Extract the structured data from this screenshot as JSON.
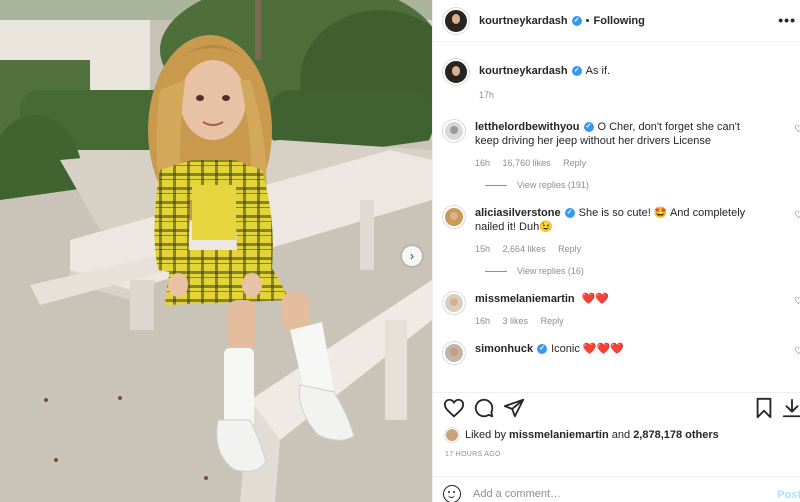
{
  "post": {
    "author": "kourtneykardash",
    "follow_state": "Following",
    "more_icon": "more-options-icon",
    "dot": "•",
    "verified_glyph": "✓"
  },
  "caption": {
    "username": "kourtneykardash",
    "text": "As if.",
    "time": "17h"
  },
  "comments": [
    {
      "username": "letthelordbewithyou",
      "verified": true,
      "text": "O Cher, don't forget she can't keep driving her jeep without her drivers License",
      "time": "16h",
      "likes": "16,760 likes",
      "reply_label": "Reply",
      "view_replies": "View replies (191)"
    },
    {
      "username": "aliciasilverstone",
      "verified": true,
      "text": "She is so cute! 🤩 And completely nailed it! Duh😉",
      "time": "15h",
      "likes": "2,664 likes",
      "reply_label": "Reply",
      "view_replies": "View replies (16)"
    },
    {
      "username": "missmelaniemartin",
      "verified": false,
      "text": "❤️❤️",
      "time": "16h",
      "likes": "3 likes",
      "reply_label": "Reply"
    },
    {
      "username": "simonhuck",
      "verified": true,
      "text": "Iconic ❤️❤️❤️"
    }
  ],
  "likes_summary": {
    "prefix": "Liked by",
    "first_user": "missmelaniemartin",
    "joiner": "and",
    "count": "2,878,178 others"
  },
  "timestamp": "17 HOURS AGO",
  "add_comment": {
    "placeholder": "Add a comment…",
    "post_label": "Post"
  },
  "icons": {
    "like": "heart-icon",
    "comment": "comment-icon",
    "share": "share-icon",
    "save": "bookmark-icon",
    "next": "chevron-right-icon"
  },
  "colors": {
    "link_blue": "#3897f0",
    "post_disabled": "#b2dffc",
    "muted": "#8e8e8e"
  }
}
